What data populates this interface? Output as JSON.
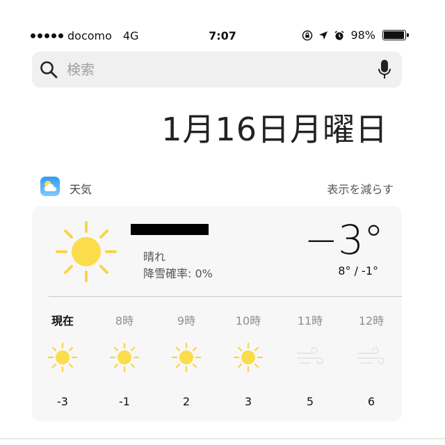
{
  "status_bar": {
    "carrier": "docomo",
    "network": "4G",
    "time": "7:07",
    "battery_percent": "98%",
    "battery_level": 0.98
  },
  "search": {
    "placeholder": "検索"
  },
  "date": "1月16日月曜日",
  "widget": {
    "app_name": "天気",
    "show_less": "表示を減らす",
    "condition": "晴れ",
    "precip": "降雪確率: 0%",
    "temp_now": "−3°",
    "temp_range": "8° / -1°",
    "hourly": [
      {
        "label": "現在",
        "temp": "-3",
        "icon": "sun-icon",
        "now": true
      },
      {
        "label": "8時",
        "temp": "-1",
        "icon": "sun-icon",
        "now": false
      },
      {
        "label": "9時",
        "temp": "2",
        "icon": "sun-icon",
        "now": false
      },
      {
        "label": "10時",
        "temp": "3",
        "icon": "sun-icon",
        "now": false
      },
      {
        "label": "11時",
        "temp": "5",
        "icon": "wind-icon",
        "now": false
      },
      {
        "label": "12時",
        "temp": "6",
        "icon": "wind-icon",
        "now": false
      }
    ]
  },
  "colors": {
    "sun": "#fbdc4a",
    "sun_rays": "#fbd24a",
    "wind": "#e6e6e6",
    "weather_app_icon": "#2d9cf5"
  }
}
